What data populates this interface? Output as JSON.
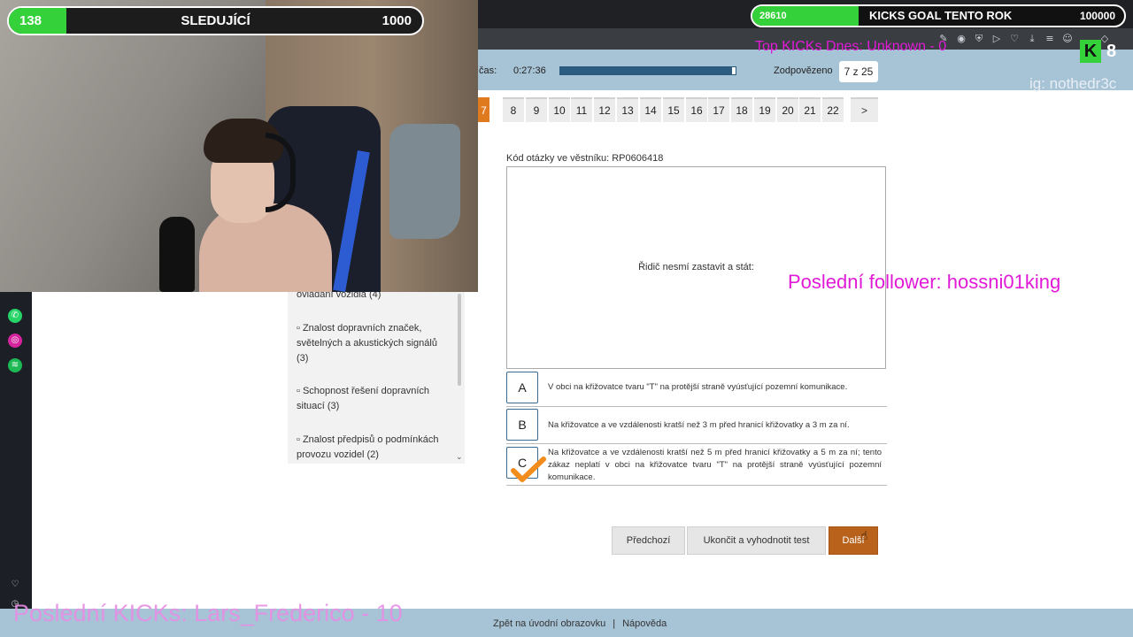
{
  "browser": {
    "toolbar_icons": [
      "edit-icon",
      "camera-icon",
      "shield-icon",
      "play-icon",
      "heart-icon",
      "download-icon",
      "settings-icon",
      "menu-icon",
      "user-icon",
      "box-icon",
      "ai-icon"
    ]
  },
  "test": {
    "time_label": "čas:",
    "time_value": "0:27:36",
    "progress": 0.98,
    "answered_label": "Zodpovězeno",
    "answered_value": "7 z 25",
    "question_numbers": [
      "7",
      "8",
      "9",
      "10",
      "11",
      "12",
      "13",
      "14",
      "15",
      "16",
      "17",
      "18",
      "19",
      "20",
      "21",
      "22"
    ],
    "active_question": "7",
    "next_page": ">",
    "question_code": "Kód otázky ve věstníku: RP0606418",
    "question_text": "Řidič nesmí zastavit a stát:",
    "answers": [
      {
        "letter": "A",
        "text": "V obci na křižovatce tvaru \"T\" na protější straně vyúsťující pozemní komunikace."
      },
      {
        "letter": "B",
        "text": "Na křižovatce a ve vzdálenosti kratší než 3 m před hranicí křižovatky a 3 m za ní."
      },
      {
        "letter": "C",
        "text": "Na křižovatce a ve vzdálenosti kratší než 5 m před hranicí křižovatky a 5 m za ní; tento zákaz neplatí v obci na křižovatce tvaru \"T\" na protější straně vyúsťující pozemní komunikace."
      }
    ],
    "selected_answer": "C",
    "buttons": {
      "prev": "Předchozí",
      "finish": "Ukončit a vyhodnotit test",
      "next": "Další"
    }
  },
  "categories": [
    "ovládání vozidla (4)",
    "▫ Znalost dopravních značek, světelných a akustických signálů (3)",
    "▫ Schopnost řešení dopravních situací (3)",
    "▫ Znalost předpisů o podmínkách provozu vozidel (2)"
  ],
  "footer": {
    "back": "Zpět na úvodní obrazovku",
    "sep": "|",
    "help": "Nápověda"
  },
  "stream": {
    "followers_current": "138",
    "followers_title": "SLEDUJÍCÍ",
    "followers_goal": "1000",
    "followers_fraction": 0.138,
    "kicks_current": "28610",
    "kicks_title": "KICKS GOAL TENTO ROK",
    "kicks_goal": "100000",
    "kicks_fraction": 0.286,
    "top_kicks": "Top KICKs Dnes: Unknown - 0",
    "kick_logo": "K",
    "kick_count": "8",
    "ig": "ig: nothedr3c",
    "last_follower": "Poslední follower: hossni01king",
    "last_kicks": "Poslední KICKs: Lars_Frederico - 10"
  },
  "sidebar_icons": [
    "whatsapp-icon",
    "instagram-icon",
    "spotify-icon",
    "heart-icon",
    "clock-icon"
  ],
  "colors": {
    "accent": "#e07a1f",
    "header": "#a7c3d6",
    "overlay": "#e11ad8",
    "kick_green": "#35d13a"
  }
}
